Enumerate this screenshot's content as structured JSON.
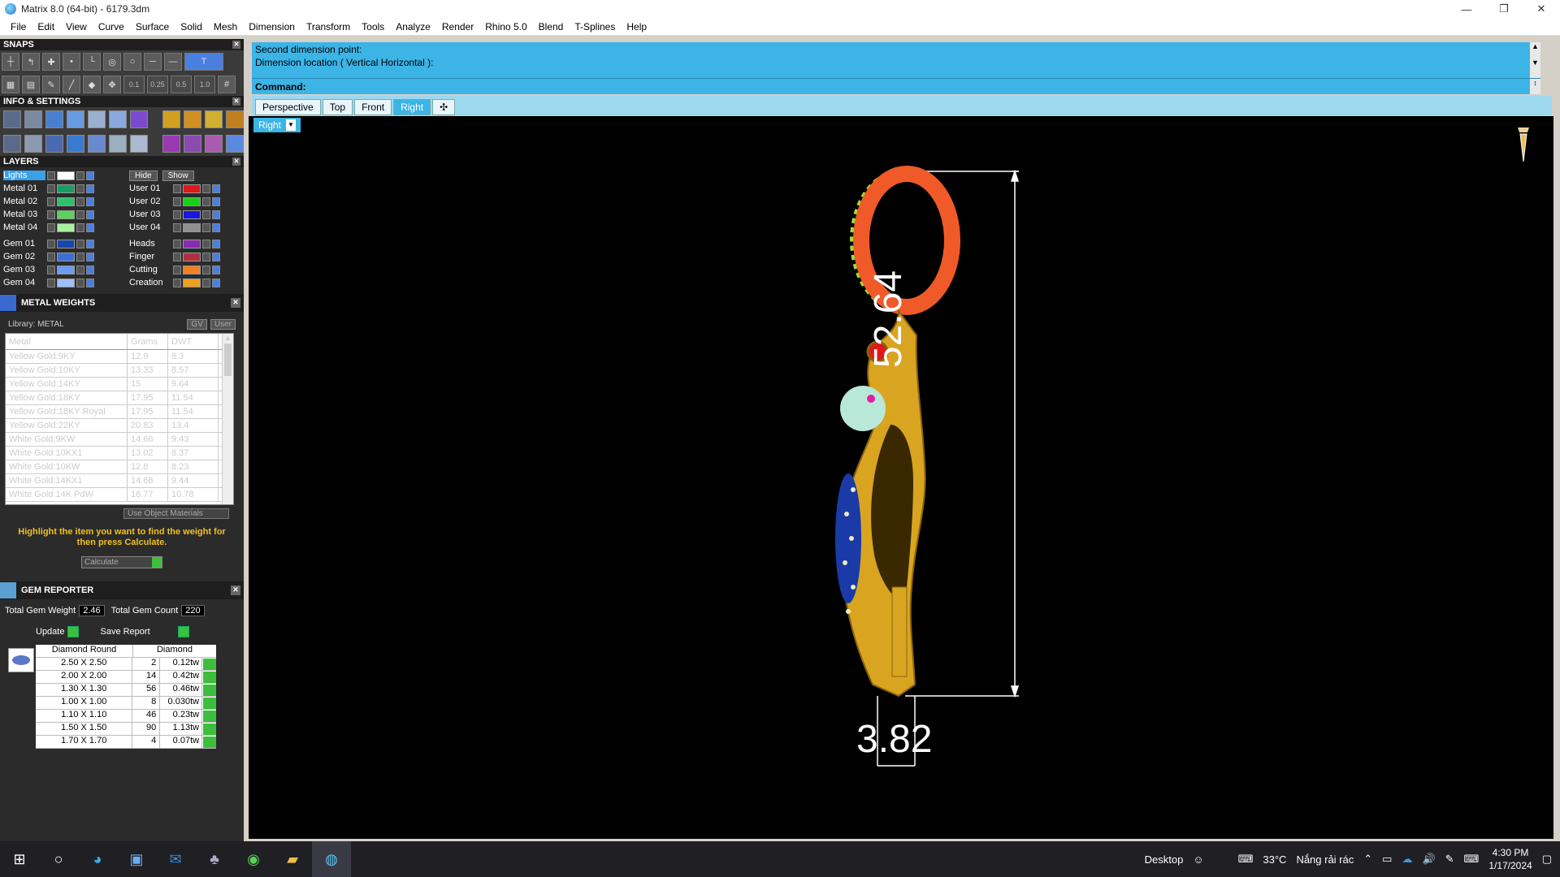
{
  "window": {
    "title": "Matrix 8.0 (64-bit) - 6179.3dm",
    "minimize": "—",
    "restore": "❐",
    "close": "✕"
  },
  "menu": [
    "File",
    "Edit",
    "View",
    "Curve",
    "Surface",
    "Solid",
    "Mesh",
    "Dimension",
    "Transform",
    "Tools",
    "Analyze",
    "Render",
    "Rhino 5.0",
    "Blend",
    "T-Splines",
    "Help"
  ],
  "snaps": {
    "title": "SNAPS",
    "values": [
      "0.1",
      "0.25",
      "0.5",
      "1.0"
    ]
  },
  "info": {
    "title": "INFO & SETTINGS"
  },
  "layers": {
    "title": "LAYERS",
    "lights": "Lights",
    "hide": "Hide",
    "show": "Show",
    "left": [
      {
        "name": "Metal 01",
        "color": "#1a9e60"
      },
      {
        "name": "Metal 02",
        "color": "#2fbf6a"
      },
      {
        "name": "Metal 03",
        "color": "#5ad35a"
      },
      {
        "name": "Metal 04",
        "color": "#a8f0a0"
      },
      {
        "name": "Gem 01",
        "color": "#1548a8"
      },
      {
        "name": "Gem 02",
        "color": "#3a70d8"
      },
      {
        "name": "Gem 03",
        "color": "#6a9cf0"
      },
      {
        "name": "Gem 04",
        "color": "#9cc0f8"
      }
    ],
    "right": [
      {
        "name": "User 01",
        "color": "#e01818"
      },
      {
        "name": "User 02",
        "color": "#18d018"
      },
      {
        "name": "User 03",
        "color": "#1818e0"
      },
      {
        "name": "User 04",
        "color": "#909090"
      },
      {
        "name": "Heads",
        "color": "#8a2ab0"
      },
      {
        "name": "Finger",
        "color": "#b03040"
      },
      {
        "name": "Cutting",
        "color": "#f08020"
      },
      {
        "name": "Creation",
        "color": "#f0a020"
      }
    ]
  },
  "metal_weights": {
    "title": "METAL WEIGHTS",
    "library": "Library: METAL",
    "gv": "GV",
    "user": "User",
    "headers": [
      "Metal",
      "Grams",
      "DWT"
    ],
    "rows": [
      [
        "Yellow Gold:9KY",
        "12.9",
        "8.3"
      ],
      [
        "Yellow Gold:10KY",
        "13.33",
        "8.57"
      ],
      [
        "Yellow Gold:14KY",
        "15",
        "9.64"
      ],
      [
        "Yellow Gold:18KY",
        "17.95",
        "11.54"
      ],
      [
        "Yellow Gold:18KY Royal",
        "17.95",
        "11.54"
      ],
      [
        "Yellow Gold:22KY",
        "20.83",
        "13.4"
      ],
      [
        "White Gold:9KW",
        "14.66",
        "9.43"
      ],
      [
        "White Gold:10KX1",
        "13.02",
        "8.37"
      ],
      [
        "White Gold:10KW",
        "12.8",
        "8.23"
      ],
      [
        "White Gold:14KX1",
        "14.68",
        "9.44"
      ],
      [
        "White Gold:14K PdW",
        "16.77",
        "10.78"
      ]
    ],
    "use_object_materials": "Use Object Materials",
    "hint": "Highlight the item you want to find the weight for then press Calculate.",
    "calculate": "Calculate"
  },
  "gem_reporter": {
    "title": "GEM REPORTER",
    "total_weight_label": "Total Gem Weight",
    "total_weight": "2.46",
    "total_count_label": "Total Gem Count",
    "total_count": "220",
    "update": "Update",
    "save_report": "Save Report",
    "headers": [
      "Diamond Round",
      "Diamond"
    ],
    "rows": [
      [
        "2.50 X 2.50",
        "2",
        "0.12tw"
      ],
      [
        "2.00 X 2.00",
        "14",
        "0.42tw"
      ],
      [
        "1.30 X 1.30",
        "56",
        "0.46tw"
      ],
      [
        "1.00 X 1.00",
        "8",
        "0.030tw"
      ],
      [
        "1.10 X 1.10",
        "46",
        "0.23tw"
      ],
      [
        "1.50 X 1.50",
        "90",
        "1.13tw"
      ],
      [
        "1.70 X 1.70",
        "4",
        "0.07tw"
      ]
    ]
  },
  "command": {
    "line1": "Second dimension point:",
    "line2": "Dimension location ( Vertical  Horizontal ):",
    "prompt": "Command:"
  },
  "tabs": [
    "Perspective",
    "Top",
    "Front",
    "Right"
  ],
  "active_tab": "Right",
  "viewport": {
    "label": "Right",
    "dim_vertical": "52.64",
    "dim_horizontal": "3.82"
  },
  "taskbar": {
    "desktop": "Desktop",
    "temp": "33°C",
    "weather": "Nắng rải rác",
    "time": "4:30 PM",
    "date": "1/17/2024"
  },
  "colors": {
    "accent": "#3cb4e6",
    "gold": "#d9a521",
    "ring": "#f05a28"
  }
}
